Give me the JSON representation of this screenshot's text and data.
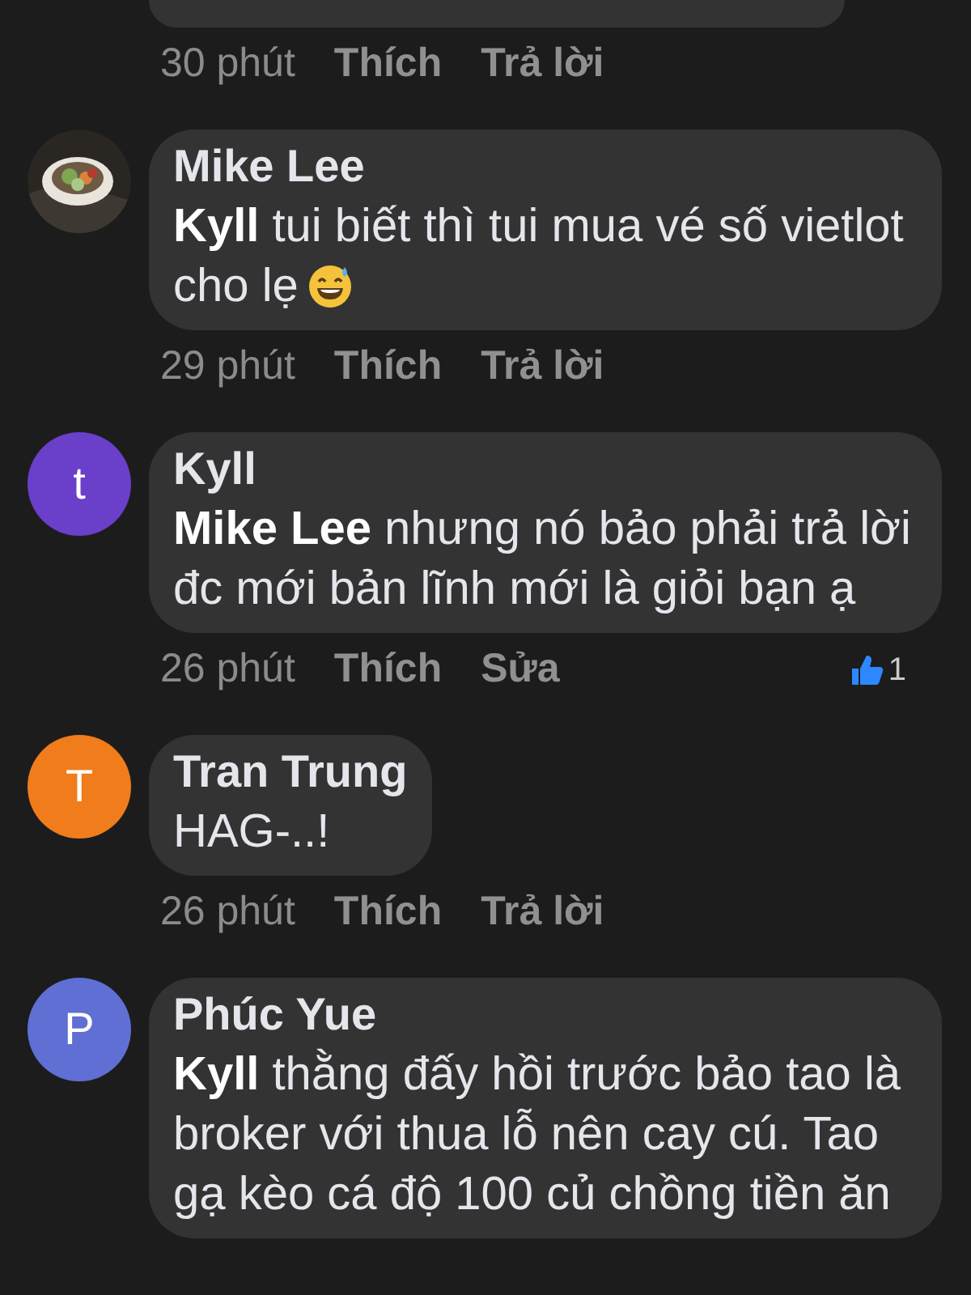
{
  "comments": [
    {
      "kind": "cut_off",
      "time": "30 phút",
      "actions": [
        "Thích",
        "Trả lời"
      ]
    },
    {
      "kind": "photo_avatar",
      "author": "Mike Lee",
      "text": "**Kyll**  tui biết thì tui mua vé số vietlot cho lẹ",
      "emoji": true,
      "time": "29 phút",
      "actions": [
        "Thích",
        "Trả lời"
      ]
    },
    {
      "kind": "letter_avatar",
      "avatar_letter": "t",
      "color": "#6a3fc9",
      "author": "Kyll",
      "text": "**Mike Lee**  nhưng nó bảo phải trả lời đc mới bản lĩnh mới là giỏi bạn ạ",
      "time": "26 phút",
      "actions": [
        "Thích",
        "Sửa"
      ],
      "like_count": "1"
    },
    {
      "kind": "letter_avatar",
      "avatar_letter": "T",
      "color": "#f07c1b",
      "author": "Tran Trung",
      "text": "HAG-..!",
      "time": "26 phút",
      "actions": [
        "Thích",
        "Trả lời"
      ]
    },
    {
      "kind": "letter_avatar",
      "avatar_letter": "P",
      "color": "#5f6fd3",
      "author": "Phúc Yue",
      "text": "**Kyll**  thằng đấy hồi trước bảo tao là broker với thua lỗ nên cay cú. Tao gạ kèo cá độ 100 củ chồng tiền ăn"
    }
  ]
}
